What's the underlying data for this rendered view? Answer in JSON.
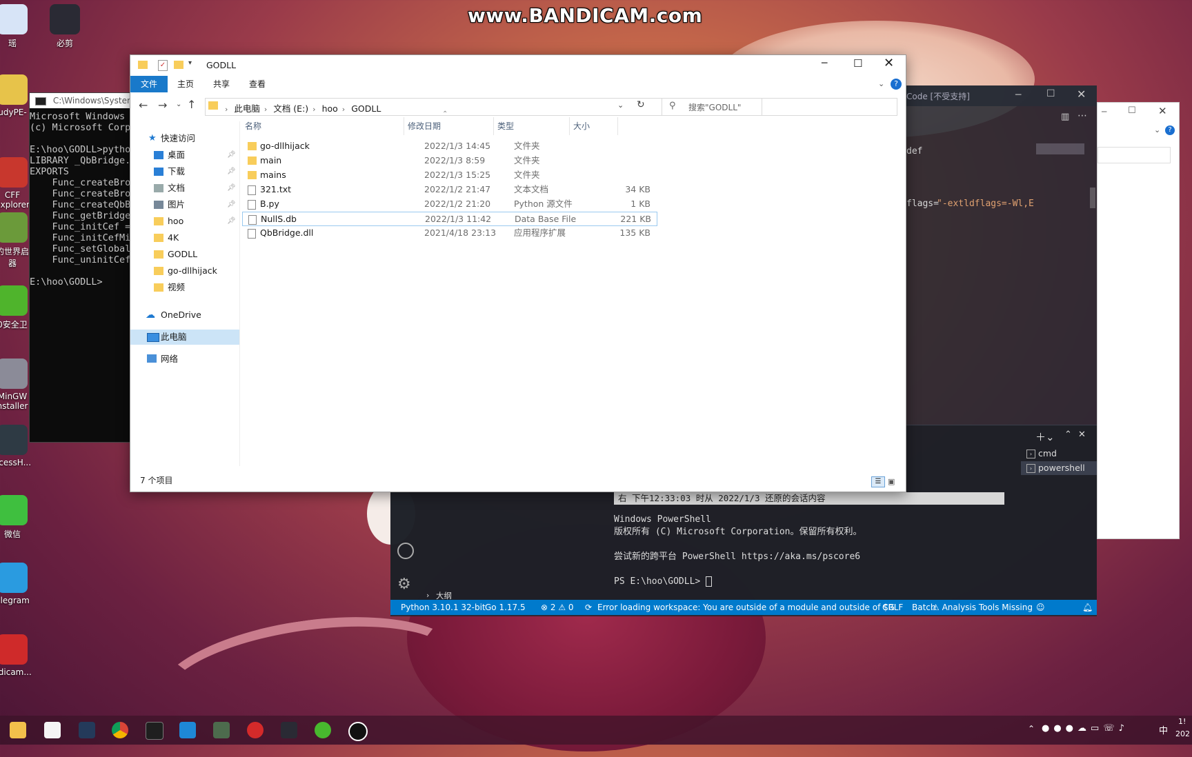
{
  "watermark": "www.BANDICAM.com",
  "desktop_icons": [
    {
      "label": "瑶",
      "color": "#d7e4f7"
    },
    {
      "label": "必剪",
      "color": "#2a2a34"
    },
    {
      "label": "udyPE-",
      "color": "#e7c34a"
    },
    {
      "label": "CFF\nExplorer",
      "color": "#c8372d"
    },
    {
      "label": "的世界启\n器",
      "color": "#6b9a3a"
    },
    {
      "label": "0安全卫",
      "color": "#4fb42c"
    },
    {
      "label": "MinGW\nnstaller",
      "color": "#8b8b98"
    },
    {
      "label": "ocessH...",
      "color": "#2e3a44"
    },
    {
      "label": "微信",
      "color": "#3fbf3f"
    },
    {
      "label": "elegram",
      "color": "#2a9be0"
    },
    {
      "label": "ndicam...",
      "color": "#cf2a2a"
    }
  ],
  "cmd": {
    "title": "C:\\Windows\\System",
    "lines": [
      "Microsoft Windows",
      "(c) Microsoft Corpo",
      "",
      "E:\\hoo\\GODLL>pytho",
      "LIBRARY _QbBridge.",
      "EXPORTS",
      "    Func_createBrov",
      "    Func_createBrov",
      "    Func_createQbB",
      "    Func_getBridge",
      "    Func_initCef =",
      "    Func_initCefMi",
      "    Func_setGlobal",
      "    Func_uninitCef",
      "",
      "E:\\hoo\\GODLL>"
    ]
  },
  "vscode": {
    "title": "Code [不受支持]",
    "code_def": "def",
    "code_flags_key": "flags=",
    "code_flags_val": "\"-extldflags=-Wl,E",
    "terminal_tabs": [
      "cmd",
      "powershell"
    ],
    "restored_banner": "右 下午12:33:03 时从 2022/1/3 还原的会话内容",
    "terminal_lines": [
      "Windows PowerShell",
      "版权所有 (C) Microsoft Corporation。保留所有权利。",
      "",
      "尝试新的跨平台 PowerShell https://aka.ms/pscore6",
      "",
      "PS E:\\hoo\\GODLL> "
    ],
    "outline_label": "大纲",
    "status": {
      "python": "Python 3.10.1 32-bit",
      "go": "Go 1.17.5",
      "problems": "⊗ 2 ⚠ 0",
      "workspace_error": "Error loading workspace: You are outside of a module and outside of $G",
      "eol": "CRLF",
      "lang": "Batch",
      "tools": "⚠ Analysis Tools Missing"
    }
  },
  "explorer": {
    "title": "GODLL",
    "ribbon_tabs": [
      "文件",
      "主页",
      "共享",
      "查看"
    ],
    "breadcrumb": [
      "此电脑",
      "文档 (E:)",
      "hoo",
      "GODLL"
    ],
    "search_placeholder": "搜索\"GODLL\"",
    "nav": {
      "quick_access": "快速访问",
      "items": [
        {
          "label": "桌面",
          "pinned": true
        },
        {
          "label": "下载",
          "pinned": true
        },
        {
          "label": "文档",
          "pinned": true
        },
        {
          "label": "图片",
          "pinned": true
        },
        {
          "label": "hoo",
          "pinned": true
        },
        {
          "label": "4K",
          "pinned": false
        },
        {
          "label": "GODLL",
          "pinned": false
        },
        {
          "label": "go-dllhijack",
          "pinned": false
        },
        {
          "label": "视频",
          "pinned": false
        }
      ],
      "onedrive": "OneDrive",
      "this_pc": "此电脑",
      "network": "网络"
    },
    "columns": [
      "名称",
      "修改日期",
      "类型",
      "大小"
    ],
    "files": [
      {
        "name": "go-dllhijack",
        "date": "2022/1/3 14:45",
        "type": "文件夹",
        "size": "",
        "kind": "folder"
      },
      {
        "name": "main",
        "date": "2022/1/3 8:59",
        "type": "文件夹",
        "size": "",
        "kind": "folder"
      },
      {
        "name": "mains",
        "date": "2022/1/3 15:25",
        "type": "文件夹",
        "size": "",
        "kind": "folder"
      },
      {
        "name": "321.txt",
        "date": "2022/1/2 21:47",
        "type": "文本文档",
        "size": "34 KB",
        "kind": "txt"
      },
      {
        "name": "B.py",
        "date": "2022/1/2 21:20",
        "type": "Python 源文件",
        "size": "1 KB",
        "kind": "py"
      },
      {
        "name": "NullS.db",
        "date": "2022/1/3 11:42",
        "type": "Data Base File",
        "size": "221 KB",
        "kind": "db"
      },
      {
        "name": "QbBridge.dll",
        "date": "2021/4/18 23:13",
        "type": "应用程序扩展",
        "size": "135 KB",
        "kind": "dll"
      }
    ],
    "item_count": "7 个项目"
  },
  "taskbar": {
    "clock_top": "1!",
    "clock_bottom": "202"
  }
}
